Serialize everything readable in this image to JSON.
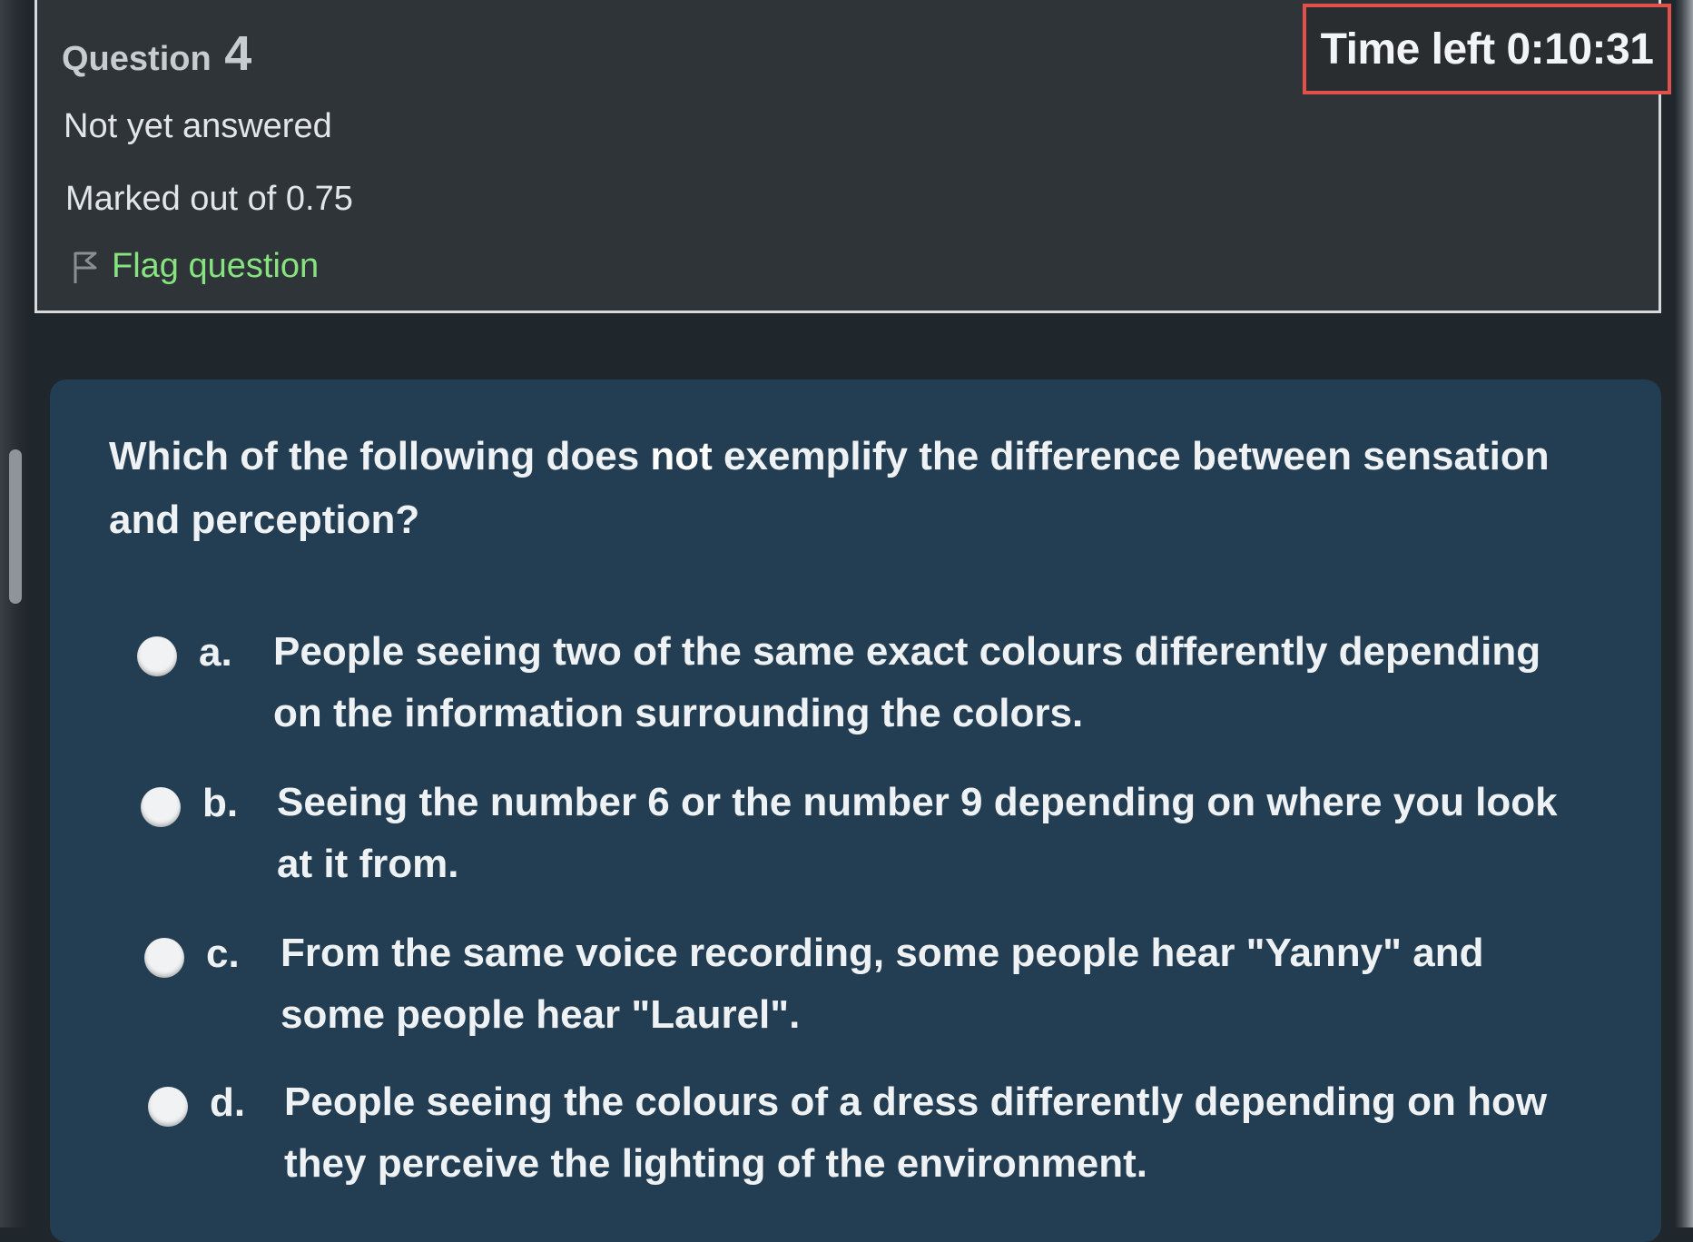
{
  "question_info": {
    "label": "Question",
    "number": "4",
    "state": "Not yet answered",
    "grade": "Marked out of 0.75",
    "flag_label": "Flag question"
  },
  "timer": {
    "text": "Time left 0:10:31"
  },
  "question": {
    "text_before": "Which of the following does ",
    "text_bold": "not",
    "text_after": " exemplify the difference between sensation and perception?"
  },
  "answers": [
    {
      "letter": "a.",
      "text": "People seeing two of the same exact colours differently depending on the information surrounding the colors."
    },
    {
      "letter": "b.",
      "text": "Seeing the number 6 or the number 9 depending on where you look at it from."
    },
    {
      "letter": "c.",
      "text": "From the same voice recording, some people hear \"Yanny\" and some people hear \"Laurel\"."
    },
    {
      "letter": "d.",
      "text": "People seeing the colours of a dress differently depending on how they perceive the lighting of the environment."
    }
  ],
  "colors": {
    "flag_link": "#86e37f",
    "timer_border": "#e2504a",
    "content_bg": "#233d52"
  }
}
